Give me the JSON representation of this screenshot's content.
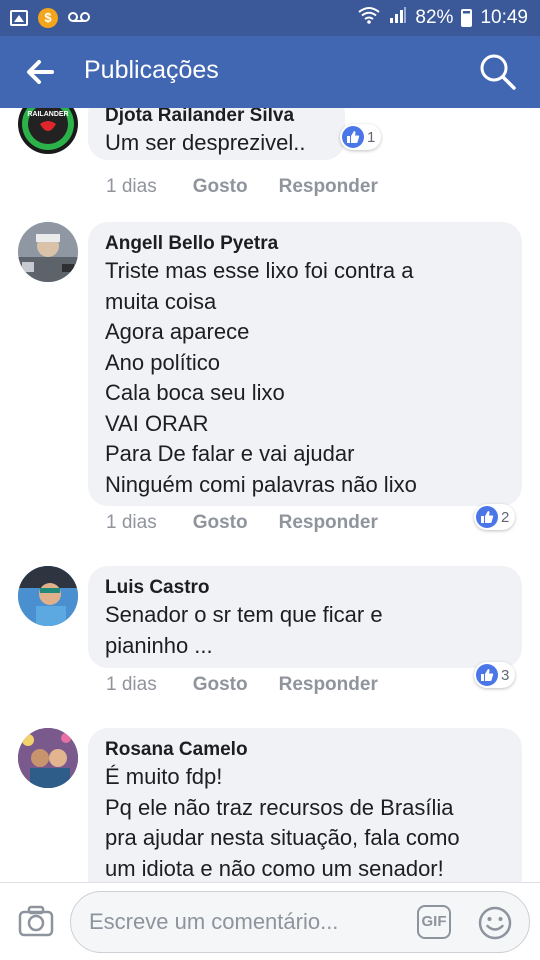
{
  "status_bar": {
    "battery": "82%",
    "time": "10:49",
    "icons": [
      "gallery-icon",
      "coin-icon",
      "voicemail-icon",
      "wifi-icon",
      "signal-icon",
      "battery-icon"
    ]
  },
  "header": {
    "title": "Publicações",
    "back_icon": "arrow-left-icon",
    "search_icon": "search-icon",
    "background": "#4267b2"
  },
  "comments": [
    {
      "author": "Djota Railander Silva",
      "avatar_text": "RAILANDER",
      "lines": [
        "Um ser desprezivel.."
      ],
      "time": "1 dias",
      "like_label": "Gosto",
      "reply_label": "Responder",
      "likes": "1"
    },
    {
      "author": "Angell Bello Pyetra",
      "lines": [
        "Triste mas esse lixo foi contra a",
        "muita coisa",
        "Agora aparece",
        "Ano político",
        "Cala boca seu lixo",
        "VAI ORAR",
        "Para De falar e vai ajudar",
        "Ninguém comi palavras não lixo"
      ],
      "time": "1 dias",
      "like_label": "Gosto",
      "reply_label": "Responder",
      "likes": "2"
    },
    {
      "author": "Luis Castro",
      "lines": [
        "Senador o sr tem que ficar e",
        "pianinho ..."
      ],
      "time": "1 dias",
      "like_label": "Gosto",
      "reply_label": "Responder",
      "likes": "3"
    },
    {
      "author": "Rosana Camelo",
      "lines": [
        "É muito fdp!",
        "Pq ele não traz recursos de Brasília",
        "pra ajudar nesta situação, fala como",
        "um idiota e não como um senador!"
      ]
    }
  ],
  "composer": {
    "placeholder": "Escreve um comentário...",
    "gif_label": "GIF",
    "camera_icon": "camera-icon",
    "emoji_icon": "emoji-icon"
  },
  "colors": {
    "brand": "#4267b2",
    "status_bar": "#3b5998",
    "bubble": "#f1f2f6",
    "like_blue": "#4a76e8"
  }
}
